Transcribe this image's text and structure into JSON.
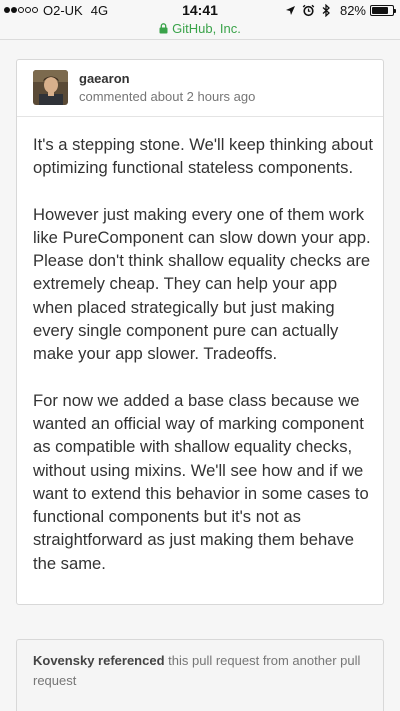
{
  "status_bar": {
    "carrier": "O2-UK",
    "network": "4G",
    "time": "14:41",
    "battery_percent_label": "82%",
    "battery_level": 0.82,
    "signal_bars_filled": 2,
    "signal_bars_total": 5
  },
  "browser": {
    "site_label": "GitHub, Inc.",
    "secure_color": "#3aa34a"
  },
  "comment": {
    "author": "gaearon",
    "meta": "commented about 2 hours ago",
    "paragraphs": [
      "It's a stepping stone. We'll keep thinking about optimizing functional stateless components.",
      "However just making every one of them work like PureComponent can slow down your app. Please don't think shallow equality checks are extremely cheap. They can help your app when placed strategically but just making every single component pure can actually make your app slower. Tradeoffs.",
      "For now we added a base class because we wanted an official way of marking component as compatible with shallow equality checks, without using mixins. We'll see how and if we want to extend this behavior in some cases to functional components but it's not as straightforward as just making them behave the same."
    ]
  },
  "reference": {
    "actor": "Kovensky",
    "action": "referenced",
    "rest": "this pull request from another pull request"
  }
}
